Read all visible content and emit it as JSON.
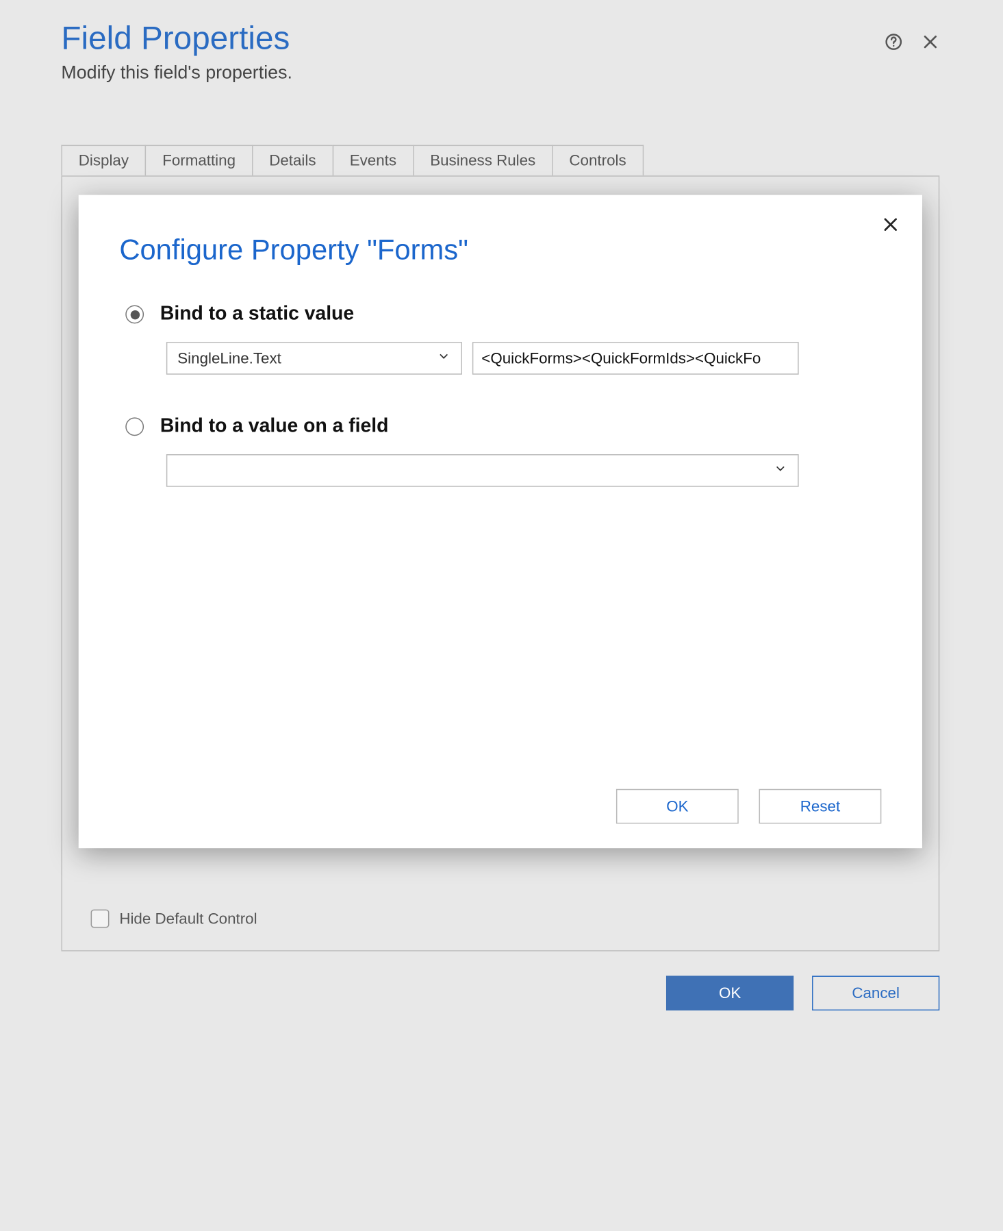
{
  "header": {
    "title": "Field Properties",
    "subtitle": "Modify this field's properties."
  },
  "tabs": [
    {
      "label": "Display"
    },
    {
      "label": "Formatting"
    },
    {
      "label": "Details"
    },
    {
      "label": "Events"
    },
    {
      "label": "Business Rules"
    },
    {
      "label": "Controls"
    }
  ],
  "panel": {
    "hide_default_label": "Hide Default Control"
  },
  "modal": {
    "title": "Configure Property \"Forms\"",
    "option_static": {
      "label": "Bind to a static value",
      "type_select": "SingleLine.Text",
      "text_value": "<QuickForms><QuickFormIds><QuickFo"
    },
    "option_field": {
      "label": "Bind to a value on a field",
      "field_select": ""
    },
    "ok": "OK",
    "reset": "Reset"
  },
  "footer": {
    "ok": "OK",
    "cancel": "Cancel"
  }
}
